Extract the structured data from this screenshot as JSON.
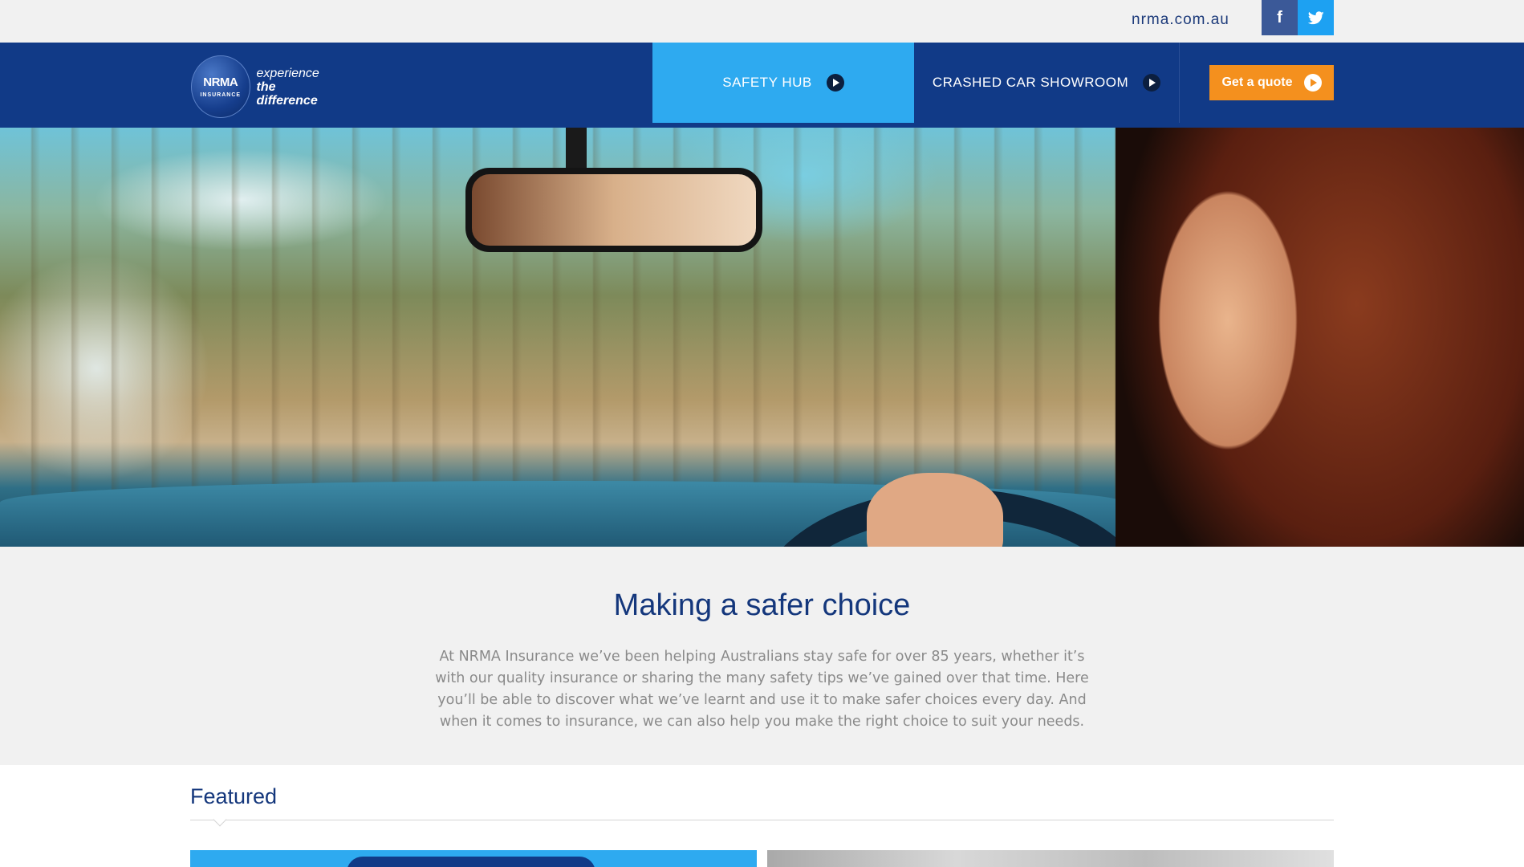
{
  "topbar": {
    "site_link": "nrma.com.au",
    "social": [
      {
        "name": "facebook",
        "glyph": "f",
        "icon": "facebook-icon",
        "color": "#3b5998"
      },
      {
        "name": "twitter",
        "glyph": "🐦",
        "icon": "twitter-icon",
        "color": "#1da1f2"
      }
    ]
  },
  "header": {
    "logo": {
      "brand": "NRMA",
      "sub": "INSURANCE",
      "tagline_1": "experience",
      "tagline_2": "the difference"
    },
    "nav": [
      {
        "label": "SAFETY HUB",
        "active": true
      },
      {
        "label": "CRASHED CAR SHOWROOM",
        "active": false
      }
    ],
    "cta_label": "Get a quote"
  },
  "hero": {
    "image": "woman-driving-car-photo"
  },
  "intro": {
    "title": "Making a safer choice",
    "body": "At NRMA Insurance we’ve been helping Australians stay safe for over 85 years, whether it’s with our quality insurance or sharing the many safety tips we’ve gained over that time. Here you’ll be able to discover what we’ve learnt and use it to make safer choices every day. And when it comes to insurance, we can also help you make the right choice to suit your needs."
  },
  "featured": {
    "heading": "Featured"
  },
  "colors": {
    "navy": "#113a87",
    "sky": "#2eaaf0",
    "orange": "#f4901e",
    "heading": "#14377c"
  }
}
